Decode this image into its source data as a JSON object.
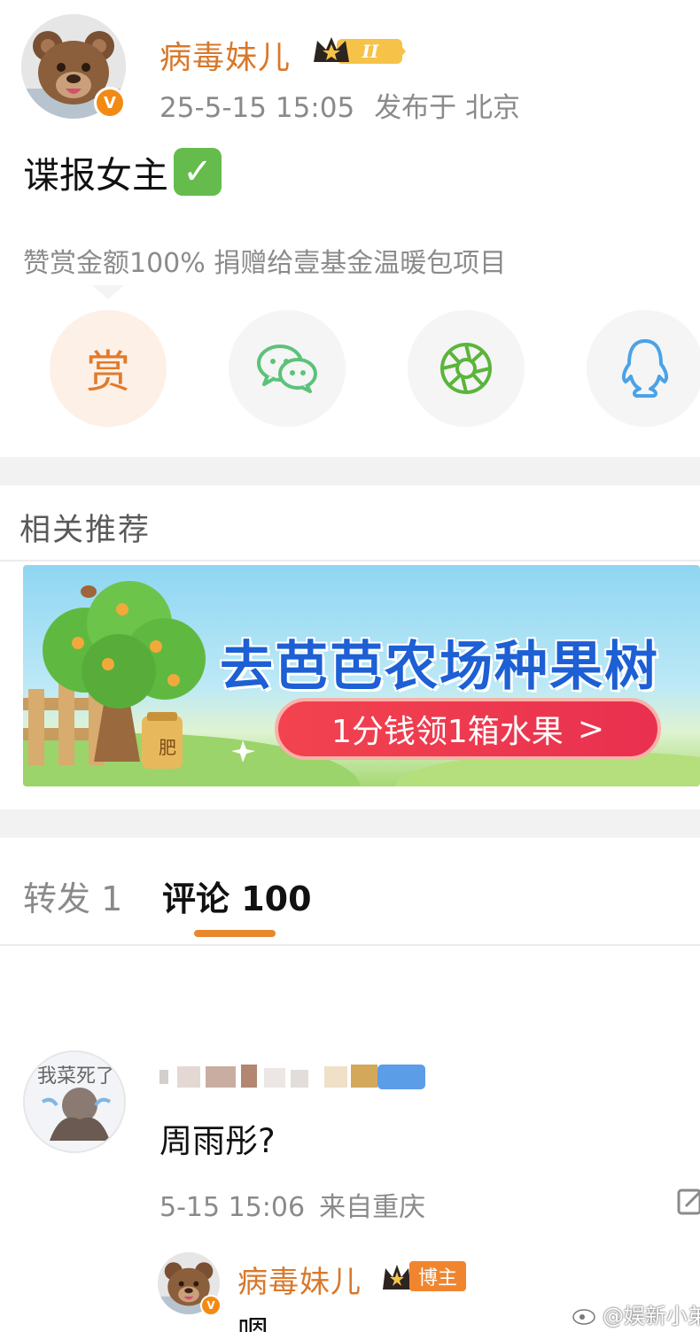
{
  "post": {
    "author": "病毒妹儿",
    "level_badge": "II",
    "timestamp": "25-5-15 15:05",
    "location": "发布于 北京",
    "text": "谍报女主",
    "check_emoji": "✓",
    "reward_note": "赞赏金额100% 捐赠给壹基金温暖包项目"
  },
  "share": {
    "reward_label": "赏",
    "buttons": [
      "reward-icon",
      "wechat-icon",
      "moments-icon",
      "qq-icon"
    ]
  },
  "recommend": {
    "title": "相关推荐"
  },
  "ad": {
    "headline": "去芭芭农场种果树",
    "cta": "1分钱领1箱水果",
    "cta_chevron": ">",
    "fertilizer_label": "肥"
  },
  "tabs": {
    "repost": "转发 1",
    "comments": "评论 100"
  },
  "comment": {
    "avatar_text": "我菜死了",
    "text": "周雨彤?",
    "time": "5-15 15:06",
    "location": "来自重庆"
  },
  "reply": {
    "author": "病毒妹儿",
    "host_badge": "博主",
    "text": "嗯"
  },
  "watermark": "@娱新小弟",
  "colors": {
    "brand_orange": "#e9872c",
    "name_orange": "#d9782b",
    "muted_text": "#8a8a8a",
    "wechat_green": "#5cc27a",
    "moments_green": "#5bb53b",
    "qq_blue": "#4aa3e8"
  }
}
